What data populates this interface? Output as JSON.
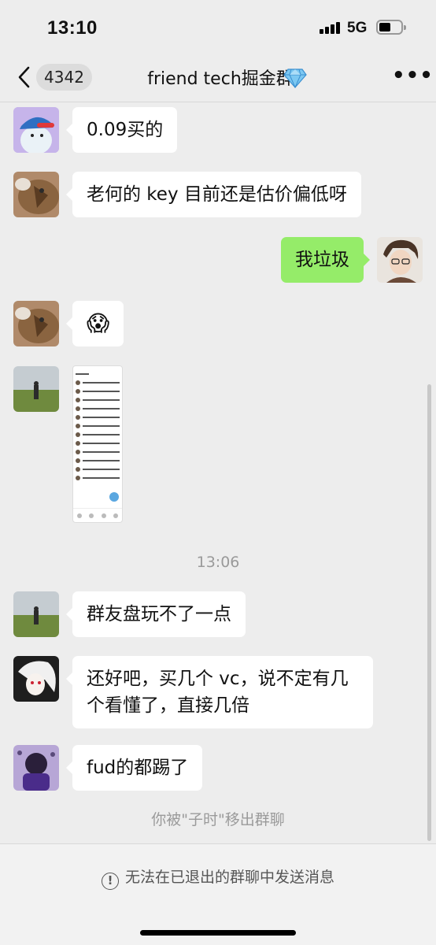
{
  "status_bar": {
    "time": "13:10",
    "network": "5G"
  },
  "nav": {
    "unread_count": "4342",
    "title": "friend tech掘金群",
    "title_icon": "gem-icon",
    "more_label": "•••"
  },
  "messages": [
    {
      "sender": "other",
      "avatar": "avatar-cartoon-cap",
      "text": "0.09买的"
    },
    {
      "sender": "other",
      "avatar": "avatar-cat",
      "text": "老何的 key 目前还是估价偏低呀"
    },
    {
      "sender": "self",
      "avatar": "avatar-anime-boy",
      "text": "我垃圾"
    },
    {
      "sender": "other",
      "avatar": "avatar-cat",
      "text": "😱"
    },
    {
      "sender": "other",
      "avatar": "avatar-field",
      "type": "image",
      "image_desc": "screenshot"
    },
    {
      "sender": "other",
      "avatar": "avatar-field",
      "text": "群友盘玩不了一点"
    },
    {
      "sender": "other",
      "avatar": "avatar-anime-white",
      "text": "还好吧，买几个 vc，说不定有几个看懂了，直接几倍"
    },
    {
      "sender": "other",
      "avatar": "avatar-purple",
      "text": "fud的都踢了"
    }
  ],
  "timestamp": "13:06",
  "system_message": "你被\"子时\"移出群聊",
  "footer": {
    "notice": "无法在已退出的群聊中发送消息",
    "icon": "info-icon"
  },
  "colors": {
    "background": "#ededed",
    "my_bubble": "#95ec69",
    "other_bubble": "#ffffff"
  }
}
